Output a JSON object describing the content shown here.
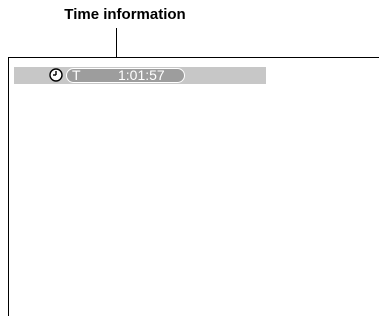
{
  "callout": {
    "label": "Time information"
  },
  "osd": {
    "icon": "clock-icon",
    "time_prefix": "T",
    "time_value": "1:01:57"
  },
  "colors": {
    "osd_bar": "#c7c7c7",
    "time_pill": "#9d9d9d",
    "osd_text": "#ffffff"
  }
}
